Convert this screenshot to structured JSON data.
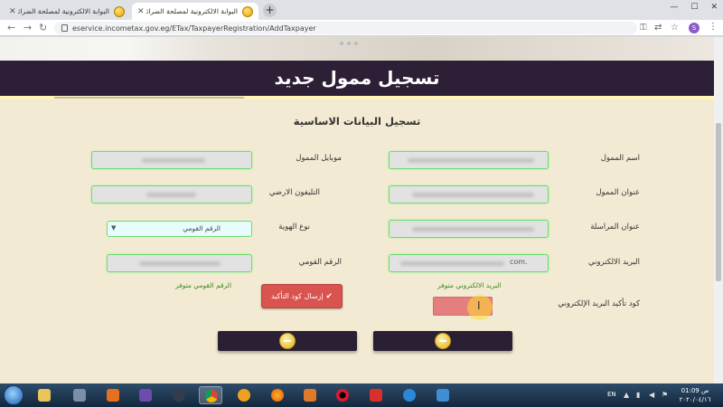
{
  "browser": {
    "tabs": [
      {
        "title": "البوابة الالكترونية لمصلحة الضرائب",
        "active": false
      },
      {
        "title": "البوابة الالكترونية لمصلحة الضرائب",
        "active": true
      }
    ],
    "url": "eservice.incometax.gov.eg/ETax/TaxpayerRegistration/AddTaxpayer",
    "profile_initial": "S",
    "close_glyph": "✕",
    "new_tab_glyph": "+"
  },
  "page": {
    "header_title": "تسجيل ممول جديد",
    "section_title": "تسجيل البيانات الاساسية",
    "fields": {
      "taxpayer_name_label": "اسم الممول",
      "mobile_label": "موبايل الممول",
      "taxpayer_address_label": "عنوان الممول",
      "landline_label": "التليفون الارضي",
      "mailing_address_label": "عنوان المراسلة",
      "id_type_label": "نوع الهوية",
      "id_type_value": "الرقم القومي",
      "email_label": "البريد الالكتروني",
      "email_suffix": "com.",
      "national_id_label": "الرقم القومي",
      "confirm_code_label": "كود تأكيد البريد الإلكتروني"
    },
    "hints": {
      "national_id_available": "الرقم القومي متوفر",
      "email_available": "البريد الالكتروني متوفر"
    },
    "send_code_button": "إرسال كود التأكيد",
    "colors": {
      "header_bg": "#2d1f35",
      "page_bg": "#f2ead3",
      "field_border": "#6edc6e",
      "send_button": "#d9534f",
      "hint_text": "#3a8a1f"
    }
  },
  "taskbar": {
    "language": "EN",
    "time": "01:09 ص",
    "date": "٢٠٢٠/٠٤/١٦"
  }
}
